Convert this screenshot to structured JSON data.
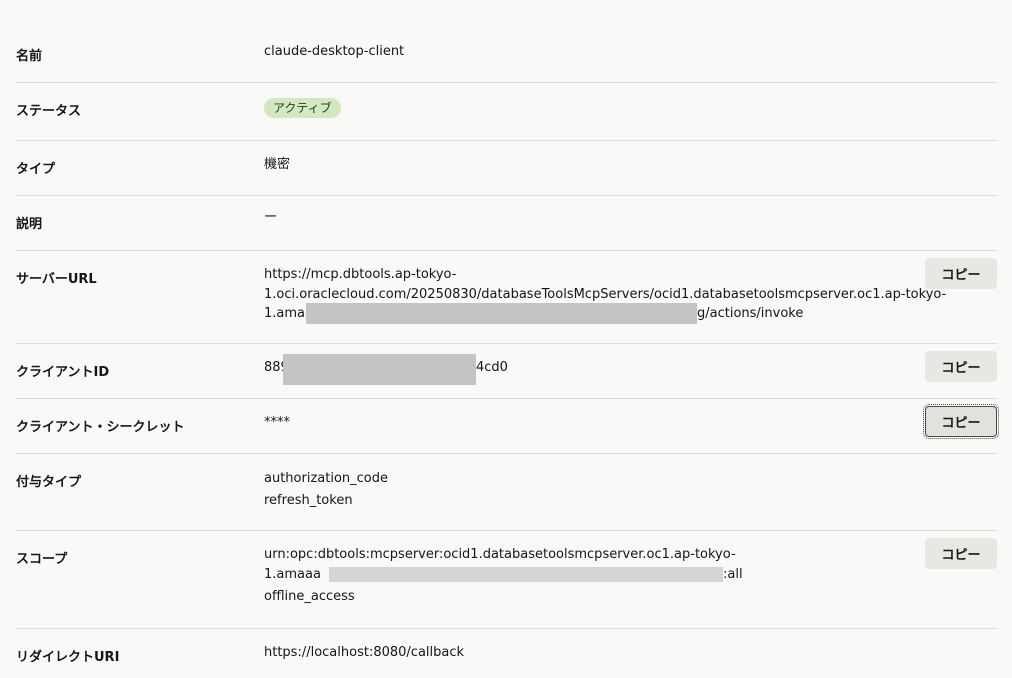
{
  "rows": [
    {
      "label": "名前",
      "value": "claude-desktop-client"
    },
    {
      "label": "ステータス",
      "badge": "アクティブ"
    },
    {
      "label": "タイプ",
      "value": "機密"
    },
    {
      "label": "説明",
      "value": "ー"
    },
    {
      "label": "サーバーURL",
      "lines": [
        "https://mcp.dbtools.ap-tokyo-",
        "1.oci.oraclecloud.com/20250830/databaseToolsMcpServers/ocid1.databasetoolsmcpserver.oc1.ap-tokyo-",
        "1.amaa",
        "g/actions/invoke"
      ],
      "copy": "コピー"
    },
    {
      "label": "クライアントID",
      "prefix": "889",
      "suffix": "4cd0",
      "copy": "コピー"
    },
    {
      "label": "クライアント・シークレット",
      "value": "****",
      "copy": "コピー"
    },
    {
      "label": "付与タイプ",
      "lines": [
        "authorization_code",
        "refresh_token"
      ]
    },
    {
      "label": "スコープ",
      "lines": [
        "urn:opc:dbtools:mcpserver:ocid1.databasetoolsmcpserver.oc1.ap-tokyo-",
        "1.amaaa",
        ":all",
        "offline_access"
      ],
      "copy": "コピー"
    },
    {
      "label": "リダイレクトURI",
      "value": "https://localhost:8080/callback"
    }
  ],
  "colors": {
    "background": "#fbf9f8",
    "divider": "#dedcd8",
    "badge_bg": "#d3e8c0",
    "button_bg": "#e9e7e4",
    "redaction": "#c4c4c4"
  }
}
